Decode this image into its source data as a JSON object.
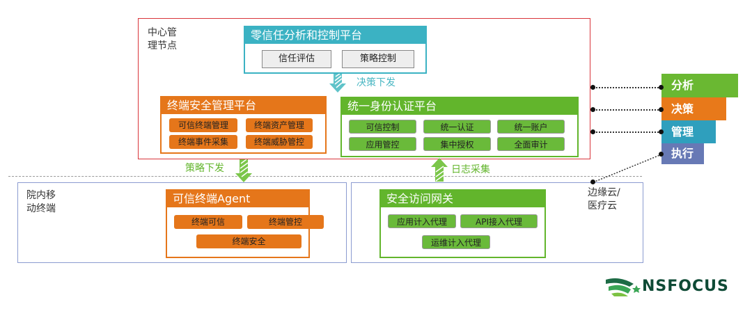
{
  "center": {
    "label": "中心管\n理节点",
    "label1": "中心管",
    "label2": "理节点"
  },
  "zt": {
    "title": "零信任分析和控制平台",
    "items": [
      "信任评估",
      "策略控制"
    ]
  },
  "arrows": {
    "decision": "决策下发",
    "policy": "策略下发",
    "log": "日志采集"
  },
  "tsm": {
    "title": "终端安全管理平台",
    "items": [
      "可信终端管理",
      "终端资产管理",
      "终端事件采集",
      "终端威胁管控"
    ]
  },
  "iam": {
    "title": "统一身份认证平台",
    "items": [
      "可信控制",
      "统一认证",
      "统一账户",
      "应用管控",
      "集中授权",
      "全面审计"
    ]
  },
  "mobile": {
    "label1": "院内移",
    "label2": "动终端"
  },
  "agent": {
    "title": "可信终端Agent",
    "items": [
      "终端可信",
      "终端管控",
      "终端安全"
    ]
  },
  "gateway": {
    "title": "安全访问网关",
    "items": [
      "应用计入代理",
      "API接入代理",
      "运维计入代理"
    ]
  },
  "edge": {
    "label1": "边缘云/",
    "label2": "医疗云"
  },
  "layers": [
    {
      "label": "分析",
      "color": "#6ab832"
    },
    {
      "label": "决策",
      "color": "#e8791a"
    },
    {
      "label": "管理",
      "color": "#2f9fbd"
    },
    {
      "label": "执行",
      "color": "#6779b5"
    }
  ],
  "logo": "NSFOCUS"
}
